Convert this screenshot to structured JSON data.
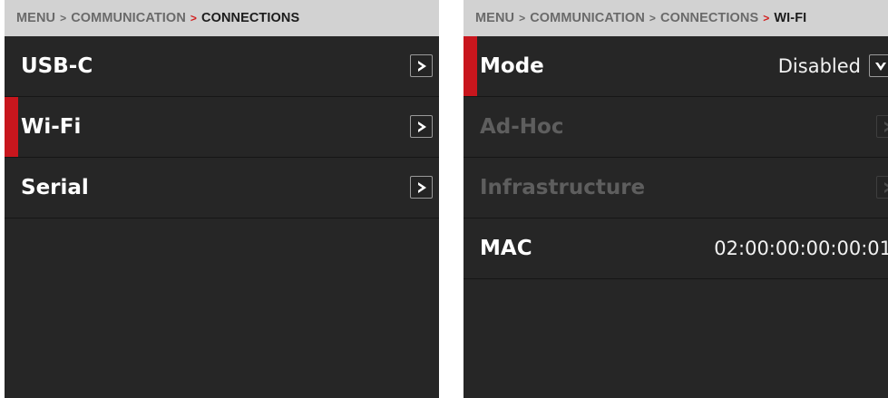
{
  "colors": {
    "accent_red": "#c8161d",
    "panel_bg": "#262626",
    "breadcrumb_bg": "#d2d2d2",
    "disabled_text": "#5e5e5e"
  },
  "left_panel": {
    "breadcrumb": {
      "items": [
        "MENU",
        "COMMUNICATION",
        "CONNECTIONS"
      ],
      "separator": ">"
    },
    "rows": [
      {
        "label": "USB-C",
        "icon": "chevron-right-icon",
        "selected": false
      },
      {
        "label": "Wi-Fi",
        "icon": "chevron-right-icon",
        "selected": true
      },
      {
        "label": "Serial",
        "icon": "chevron-right-icon",
        "selected": false
      }
    ]
  },
  "right_panel": {
    "breadcrumb": {
      "items": [
        "MENU",
        "COMMUNICATION",
        "CONNECTIONS",
        "WI-FI"
      ],
      "separator": ">"
    },
    "rows": [
      {
        "label": "Mode",
        "value": "Disabled",
        "icon": "chevron-down-icon",
        "selected": true,
        "enabled": true
      },
      {
        "label": "Ad-Hoc",
        "icon": "chevron-right-icon",
        "enabled": false
      },
      {
        "label": "Infrastructure",
        "icon": "chevron-right-icon",
        "enabled": false
      },
      {
        "label": "MAC",
        "value": "02:00:00:00:00:01",
        "enabled": true
      }
    ]
  }
}
